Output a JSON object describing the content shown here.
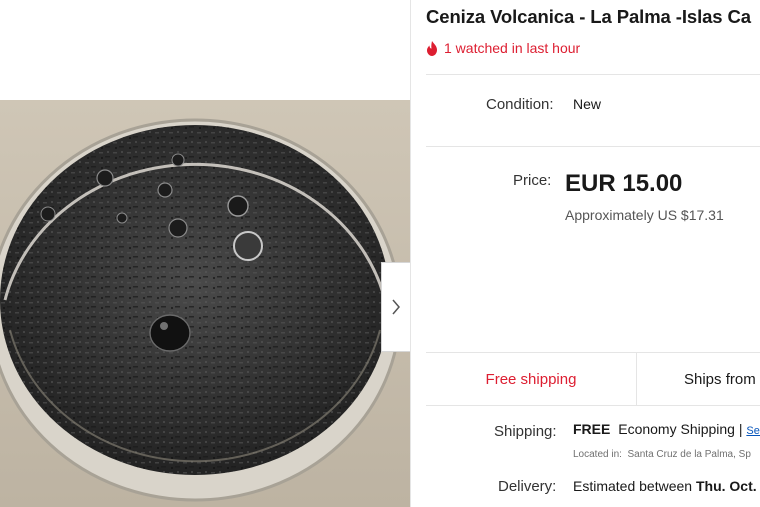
{
  "listing": {
    "title": "Ceniza Volcanica - La Palma -Islas Ca",
    "watch_text": "1 watched in last hour",
    "condition_label": "Condition:",
    "condition_value": "New",
    "price_label": "Price:",
    "price_value": "EUR 15.00",
    "approx_price": "Approximately US $17.31",
    "free_shipping_tab": "Free shipping",
    "ships_from_tab": "Ships from",
    "shipping_label": "Shipping:",
    "shipping_free": "FREE",
    "shipping_method": "Economy Shipping |",
    "shipping_link": "See",
    "located_label": "Located in:",
    "located_value": "Santa Cruz de la Palma, Sp",
    "delivery_label": "Delivery:",
    "delivery_text": "Estimated between",
    "delivery_date": "Thu. Oct."
  },
  "icons": {
    "watch": "flame-icon",
    "next": "chevron-right-icon"
  },
  "colors": {
    "alert": "#dd1e31",
    "link": "#0654ba"
  }
}
